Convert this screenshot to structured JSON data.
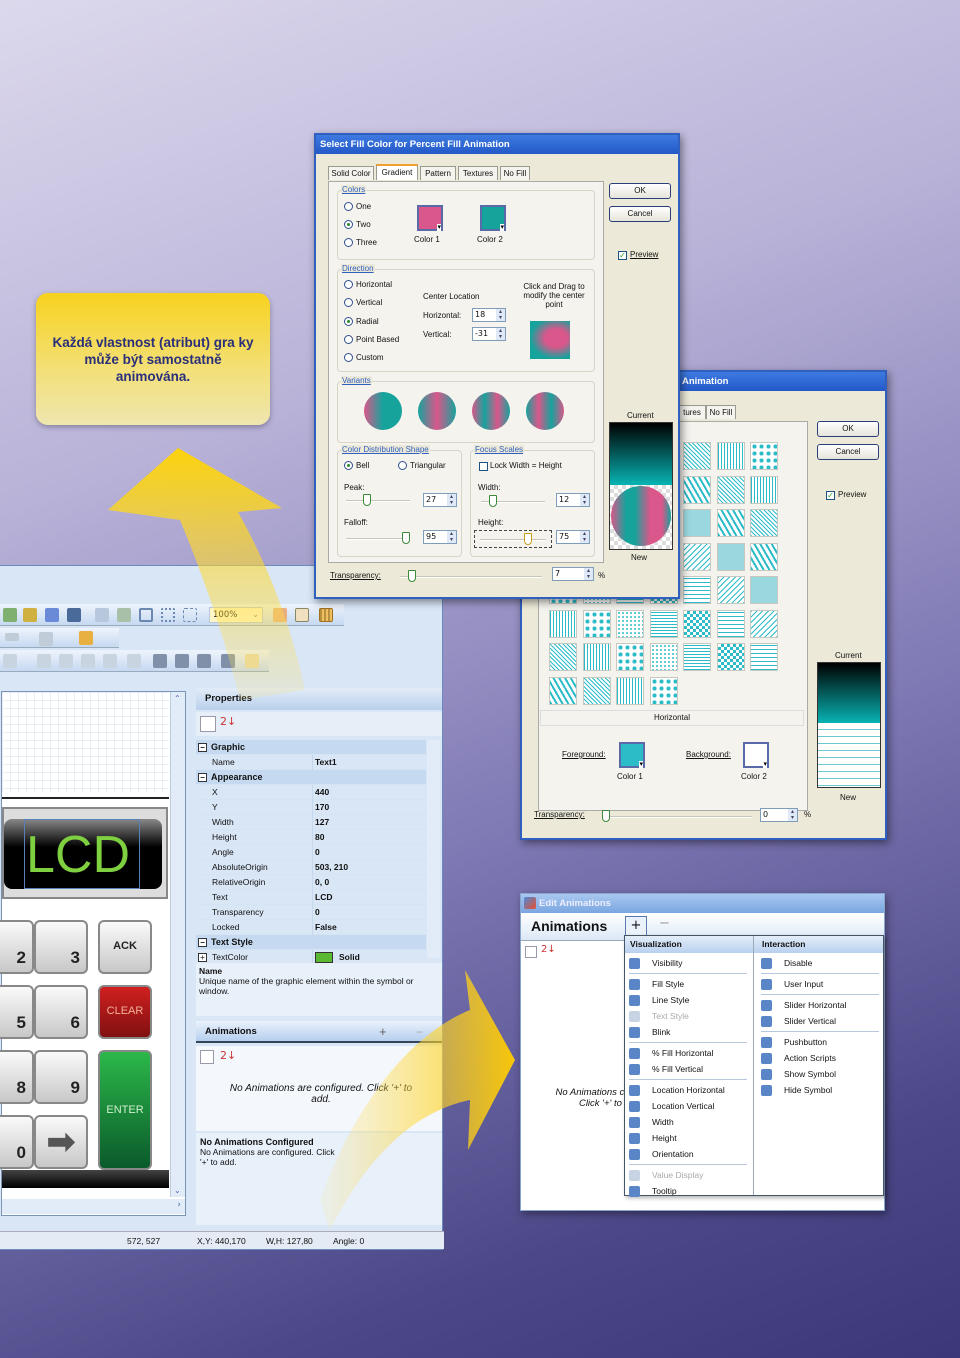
{
  "callout": {
    "text": "Každá vlastnost (atribut) gra  ky může být samostatně animována."
  },
  "fill_dialog": {
    "title": "Select Fill Color for Percent Fill Animation",
    "tabs": [
      "Solid Color",
      "Gradient",
      "Pattern",
      "Textures",
      "No Fill"
    ],
    "selected_tab": "Gradient",
    "ok": "OK",
    "cancel": "Cancel",
    "preview": "Preview",
    "preview_checked": true,
    "colors": {
      "label": "Colors",
      "options": [
        "One",
        "Two",
        "Three"
      ],
      "selected": "Two",
      "color1_label": "Color 1",
      "color1": "#d9578a",
      "color2_label": "Color 2",
      "color2": "#16a39c"
    },
    "direction": {
      "label": "Direction",
      "options": [
        "Horizontal",
        "Vertical",
        "Radial",
        "Point Based",
        "Custom"
      ],
      "selected": "Radial",
      "center_location": "Center Location",
      "horizontal_label": "Horizontal:",
      "horizontal": "18",
      "vertical_label": "Vertical:",
      "vertical": "-31",
      "hint": "Click and Drag to modify the center point"
    },
    "variants_label": "Variants",
    "distribution": {
      "label": "Color Distribution Shape",
      "options": [
        "Bell",
        "Triangular"
      ],
      "selected": "Bell",
      "peak_label": "Peak:",
      "peak": "27",
      "falloff_label": "Falloff:",
      "falloff": "95"
    },
    "focus": {
      "label": "Focus Scales",
      "lock": "Lock Width = Height",
      "lock_checked": false,
      "width_label": "Width:",
      "width": "12",
      "height_label": "Height:",
      "height": "75"
    },
    "current": "Current",
    "new": "New",
    "transparency_label": "Transparency:",
    "transparency": "7",
    "percent": "%"
  },
  "pattern_dialog": {
    "title": "Animation",
    "tabs": [
      "tures",
      "No Fill"
    ],
    "ok": "OK",
    "cancel": "Cancel",
    "preview": "Preview",
    "pattern_name": "Horizontal",
    "foreground_label": "Foreground:",
    "foreground_color_label": "Color 1",
    "foreground": "#2bbcc8",
    "background_label": "Background:",
    "background_color_label": "Color 2",
    "background": "#ffffff",
    "current": "Current",
    "new": "New",
    "transparency_label": "Transparency:",
    "transparency": "0",
    "percent": "%"
  },
  "app": {
    "zoom": "100%",
    "lcd_text": "LCD",
    "keys": [
      "2",
      "3",
      "ACK",
      "5",
      "6",
      "CLEAR",
      "8",
      "9",
      "ENTER",
      "0"
    ],
    "properties": {
      "title": "Properties",
      "rows": [
        {
          "cat": true,
          "key": "Graphic"
        },
        {
          "key": "Name",
          "value": "Text1"
        },
        {
          "cat": true,
          "key": "Appearance"
        },
        {
          "key": "X",
          "value": "440"
        },
        {
          "key": "Y",
          "value": "170"
        },
        {
          "key": "Width",
          "value": "127"
        },
        {
          "key": "Height",
          "value": "80"
        },
        {
          "key": "Angle",
          "value": "0"
        },
        {
          "key": "AbsoluteOrigin",
          "value": "503, 210"
        },
        {
          "key": "RelativeOrigin",
          "value": "0, 0"
        },
        {
          "key": "Text",
          "value": "LCD"
        },
        {
          "key": "Transparency",
          "value": "0"
        },
        {
          "key": "Locked",
          "value": "False"
        },
        {
          "cat": true,
          "key": "Text Style"
        },
        {
          "key": "TextColor",
          "value": "Solid",
          "expand": true,
          "color": "#5ab832"
        }
      ],
      "desc_title": "Name",
      "desc_text": "Unique name of the graphic element within the symbol or window."
    },
    "animations": {
      "title": "Animations",
      "add": "+",
      "remove": "−",
      "empty": "No Animations are configured. Click '+' to add.",
      "info_title": "No Animations Configured",
      "info_text": "No Animations are configured. Click '+' to add."
    },
    "status": {
      "mouse": "572, 527",
      "xy": "X,Y: 440,170",
      "wh": "W,H: 127,80",
      "angle": "Angle: 0"
    }
  },
  "edit_animations": {
    "title": "Edit Animations",
    "header": "Animations",
    "add": "+",
    "remove": "−",
    "empty": "No Animations configured. Click '+' to add.",
    "visualization_label": "Visualization",
    "interaction_label": "Interaction",
    "visualization": [
      {
        "label": "Visibility"
      },
      {
        "sep": true
      },
      {
        "label": "Fill Style"
      },
      {
        "label": "Line Style"
      },
      {
        "label": "Text Style",
        "disabled": true
      },
      {
        "label": "Blink"
      },
      {
        "sep": true
      },
      {
        "label": "% Fill Horizontal"
      },
      {
        "label": "% Fill Vertical"
      },
      {
        "sep": true
      },
      {
        "label": "Location Horizontal"
      },
      {
        "label": "Location Vertical"
      },
      {
        "label": "Width"
      },
      {
        "label": "Height"
      },
      {
        "label": "Orientation"
      },
      {
        "sep": true
      },
      {
        "label": "Value Display",
        "disabled": true
      },
      {
        "label": "Tooltip"
      }
    ],
    "interaction": [
      {
        "label": "Disable"
      },
      {
        "sep": true
      },
      {
        "label": "User Input"
      },
      {
        "sep": true
      },
      {
        "label": "Slider Horizontal"
      },
      {
        "label": "Slider Vertical"
      },
      {
        "sep": true
      },
      {
        "label": "Pushbutton"
      },
      {
        "label": "Action Scripts"
      },
      {
        "label": "Show Symbol"
      },
      {
        "label": "Hide Symbol"
      }
    ]
  }
}
